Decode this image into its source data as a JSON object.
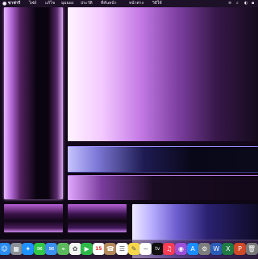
{
  "menubar": {
    "app_name": "ซาฟารี",
    "menu_items": [
      "ไฟล์",
      "แก้ไข",
      "มุมมอง",
      "ประวัติ",
      "ที่คั่นหน้า",
      "หน้าต่าง",
      "วิธีใช้"
    ]
  },
  "dock": {
    "items": [
      {
        "name": "finder-icon",
        "bg": "#2a8cf0",
        "glyph": "☺"
      },
      {
        "name": "launchpad-icon",
        "bg": "#8a8f98",
        "glyph": "▦"
      },
      {
        "name": "safari-icon",
        "bg": "#1e90ff",
        "glyph": "✦"
      },
      {
        "name": "messages-icon",
        "bg": "#33c748",
        "glyph": "✉"
      },
      {
        "name": "mail-icon",
        "bg": "#3b8ff0",
        "glyph": "✉"
      },
      {
        "name": "maps-icon",
        "bg": "#5cb85c",
        "glyph": "⌖"
      },
      {
        "name": "photos-icon",
        "bg": "#f5f5f5",
        "glyph": "✿"
      },
      {
        "name": "facetime-icon",
        "bg": "#2fb84a",
        "glyph": "▶"
      },
      {
        "name": "calendar-icon",
        "bg": "#ffffff",
        "glyph": "15",
        "kind": "calendar"
      },
      {
        "name": "contacts-icon",
        "bg": "#b48a5c",
        "glyph": "☎"
      },
      {
        "name": "reminders-icon",
        "bg": "#ffffff",
        "glyph": "☰"
      },
      {
        "name": "notes-icon",
        "bg": "#f7d84a",
        "glyph": "✎"
      },
      {
        "name": "freeform-icon",
        "bg": "#ffffff",
        "glyph": "~"
      },
      {
        "name": "appletv-icon",
        "bg": "#111111",
        "glyph": "tv"
      },
      {
        "name": "music-icon",
        "bg": "#fa3c55",
        "glyph": "♫"
      },
      {
        "name": "podcasts-icon",
        "bg": "#9b4fd8",
        "glyph": "◉"
      },
      {
        "name": "appstore-icon",
        "bg": "#1a8cff",
        "glyph": "A"
      },
      {
        "name": "settings-icon",
        "bg": "#7d7d7d",
        "glyph": "⚙"
      },
      {
        "name": "word-icon",
        "bg": "#2b5cb8",
        "glyph": "W"
      },
      {
        "name": "excel-icon",
        "bg": "#1f7a44",
        "glyph": "X"
      },
      {
        "name": "powerpoint-icon",
        "bg": "#d04a2a",
        "glyph": "P"
      },
      {
        "name": "trash-icon",
        "bg": "#7a7a7a",
        "glyph": "🗑"
      }
    ]
  }
}
